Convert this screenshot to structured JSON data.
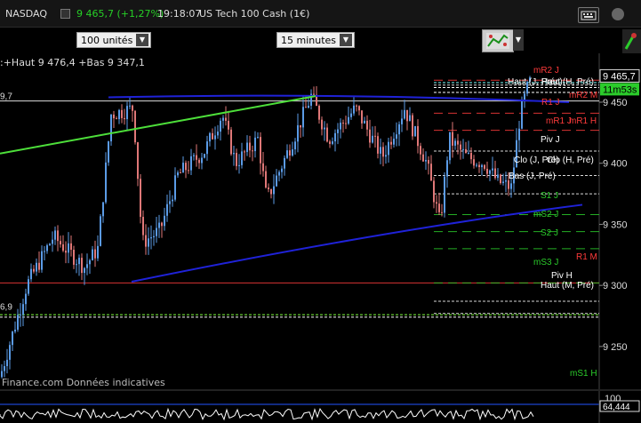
{
  "header": {
    "instrument": "NASDAQ",
    "price": "9 465,7 (+1,27%)",
    "time": "19:18:07",
    "name": "US Tech 100 Cash (1€)"
  },
  "toolbar": {
    "units_value": "100 unités",
    "interval_value": "15 minutes"
  },
  "legend_text": ":+Haut 9 476,4 +Bas 9 347,1",
  "watermark": "Finance.com Données indicatives",
  "left_labels": {
    "upper": "9,7",
    "lower": "6,9"
  },
  "price_axis": {
    "ticks": [
      "9 450",
      "9 400",
      "9 350",
      "9 300",
      "9 250"
    ],
    "price_tag": "9 465,7",
    "timer_tag": "11m53s"
  },
  "level_labels": [
    {
      "text": "mR2 J",
      "color": "#ff3b3b"
    },
    {
      "text": "Haut (J, Préc)",
      "color": "#ffffff"
    },
    {
      "text": "Haut (H, Pré)",
      "color": "#ffffff"
    },
    {
      "text": "mR2 M",
      "color": "#ff3b3b"
    },
    {
      "text": "R1 J",
      "color": "#ff3b3b"
    },
    {
      "text": "mR1 J",
      "color": "#ff3b3b"
    },
    {
      "text": "mR1 H",
      "color": "#ff3b3b"
    },
    {
      "text": "Piv J",
      "color": "#ffffff"
    },
    {
      "text": "Clo (J, Pré)",
      "color": "#ffffff"
    },
    {
      "text": "Clo (H, Pré)",
      "color": "#ffffff"
    },
    {
      "text": "Bas (J, Pré)",
      "color": "#ffffff"
    },
    {
      "text": "S1 J",
      "color": "#2bcc2b"
    },
    {
      "text": "mS2 J",
      "color": "#2bcc2b"
    },
    {
      "text": "S2 J",
      "color": "#2bcc2b"
    },
    {
      "text": "R1 M",
      "color": "#ff3b3b"
    },
    {
      "text": "mS3 J",
      "color": "#2bcc2b"
    },
    {
      "text": "Piv H",
      "color": "#ffffff"
    },
    {
      "text": "Haut (M, Pré)",
      "color": "#ffffff"
    },
    {
      "text": "mS1 H",
      "color": "#2bcc2b"
    }
  ],
  "oscillator": {
    "upper": "100",
    "value": "64,444"
  },
  "chart_data": {
    "type": "candlestick",
    "ylim": [
      9215,
      9490
    ],
    "levels": [
      {
        "name": "mR2 J",
        "value": 9468,
        "color": "#ff3b3b"
      },
      {
        "name": "Haut (J, Préc)",
        "value": 9464,
        "color": "#ffffff"
      },
      {
        "name": "R1 J",
        "value": 9441,
        "color": "#ff3b3b"
      },
      {
        "name": "mR1 J",
        "value": 9427,
        "color": "#ff3b3b"
      },
      {
        "name": "Piv J",
        "value": 9410,
        "color": "#ffffff"
      },
      {
        "name": "Clo (J, Pré)",
        "value": 9390,
        "color": "#ffffff"
      },
      {
        "name": "Bas (J, Pré)",
        "value": 9375,
        "color": "#ffffff"
      },
      {
        "name": "S1 J",
        "value": 9358,
        "color": "#2bcc2b"
      },
      {
        "name": "mS2 J",
        "value": 9344,
        "color": "#2bcc2b"
      },
      {
        "name": "S2 J",
        "value": 9330,
        "color": "#2bcc2b"
      },
      {
        "name": "R1 M",
        "value": 9302,
        "color": "#ff3b3b"
      },
      {
        "name": "mS3 J",
        "value": 9302,
        "color": "#2bcc2b"
      },
      {
        "name": "Piv H",
        "value": 9287,
        "color": "#ffffff"
      },
      {
        "name": "Haut (M, Pré)",
        "value": 9277,
        "color": "#ffffff"
      },
      {
        "name": "mS1 H",
        "value": 9208,
        "color": "#2bcc2b"
      }
    ],
    "current_price": 9465.7,
    "ref_line": 9451,
    "channel_top": 9454,
    "channel_bottom_start": 9303,
    "channel_bottom_end": 9366,
    "green_trend_start": 9408,
    "green_trend_end": 9455
  }
}
